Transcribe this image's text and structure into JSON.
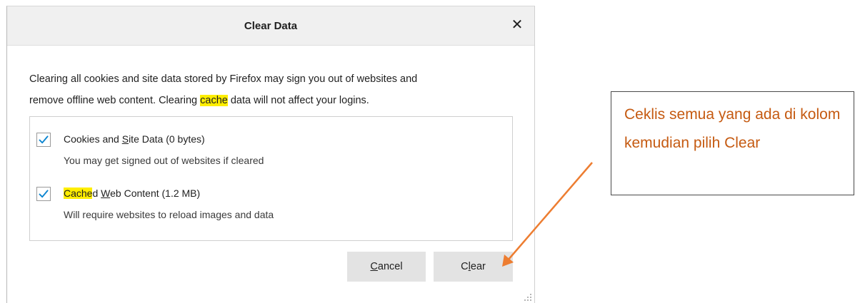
{
  "dialog": {
    "title": "Clear Data",
    "close_symbol": "✕",
    "description": {
      "line1": "Clearing all cookies and site data stored by Firefox may sign you out of websites and",
      "line2_pre": "remove offline web content. Clearing ",
      "line2_highlight": "cache",
      "line2_post": " data will not affect your logins."
    },
    "options": [
      {
        "checked": true,
        "label_pre": "Cookies and ",
        "label_access": "S",
        "label_post": "ite Data (0 bytes)",
        "sublabel": "You may get signed out of websites if cleared"
      },
      {
        "checked": true,
        "label_highlight": "Cache",
        "label_mid": "d ",
        "label_access": "W",
        "label_post": "eb Content (1.2 MB)",
        "sublabel": "Will require websites to reload images and data"
      }
    ],
    "buttons": {
      "cancel_access": "C",
      "cancel_rest": "ancel",
      "clear_pre": "C",
      "clear_access": "l",
      "clear_post": "ear"
    }
  },
  "annotation": {
    "text": "Ceklis semua yang ada di kolom kemudian pilih Clear",
    "color": "#c55a11",
    "arrow_color": "#ed7d31"
  },
  "colors": {
    "highlight": "#ffee00",
    "checkmark": "#0a84d0",
    "button_bg": "#e3e3e3",
    "titlebar_bg": "#f0f0f0"
  }
}
